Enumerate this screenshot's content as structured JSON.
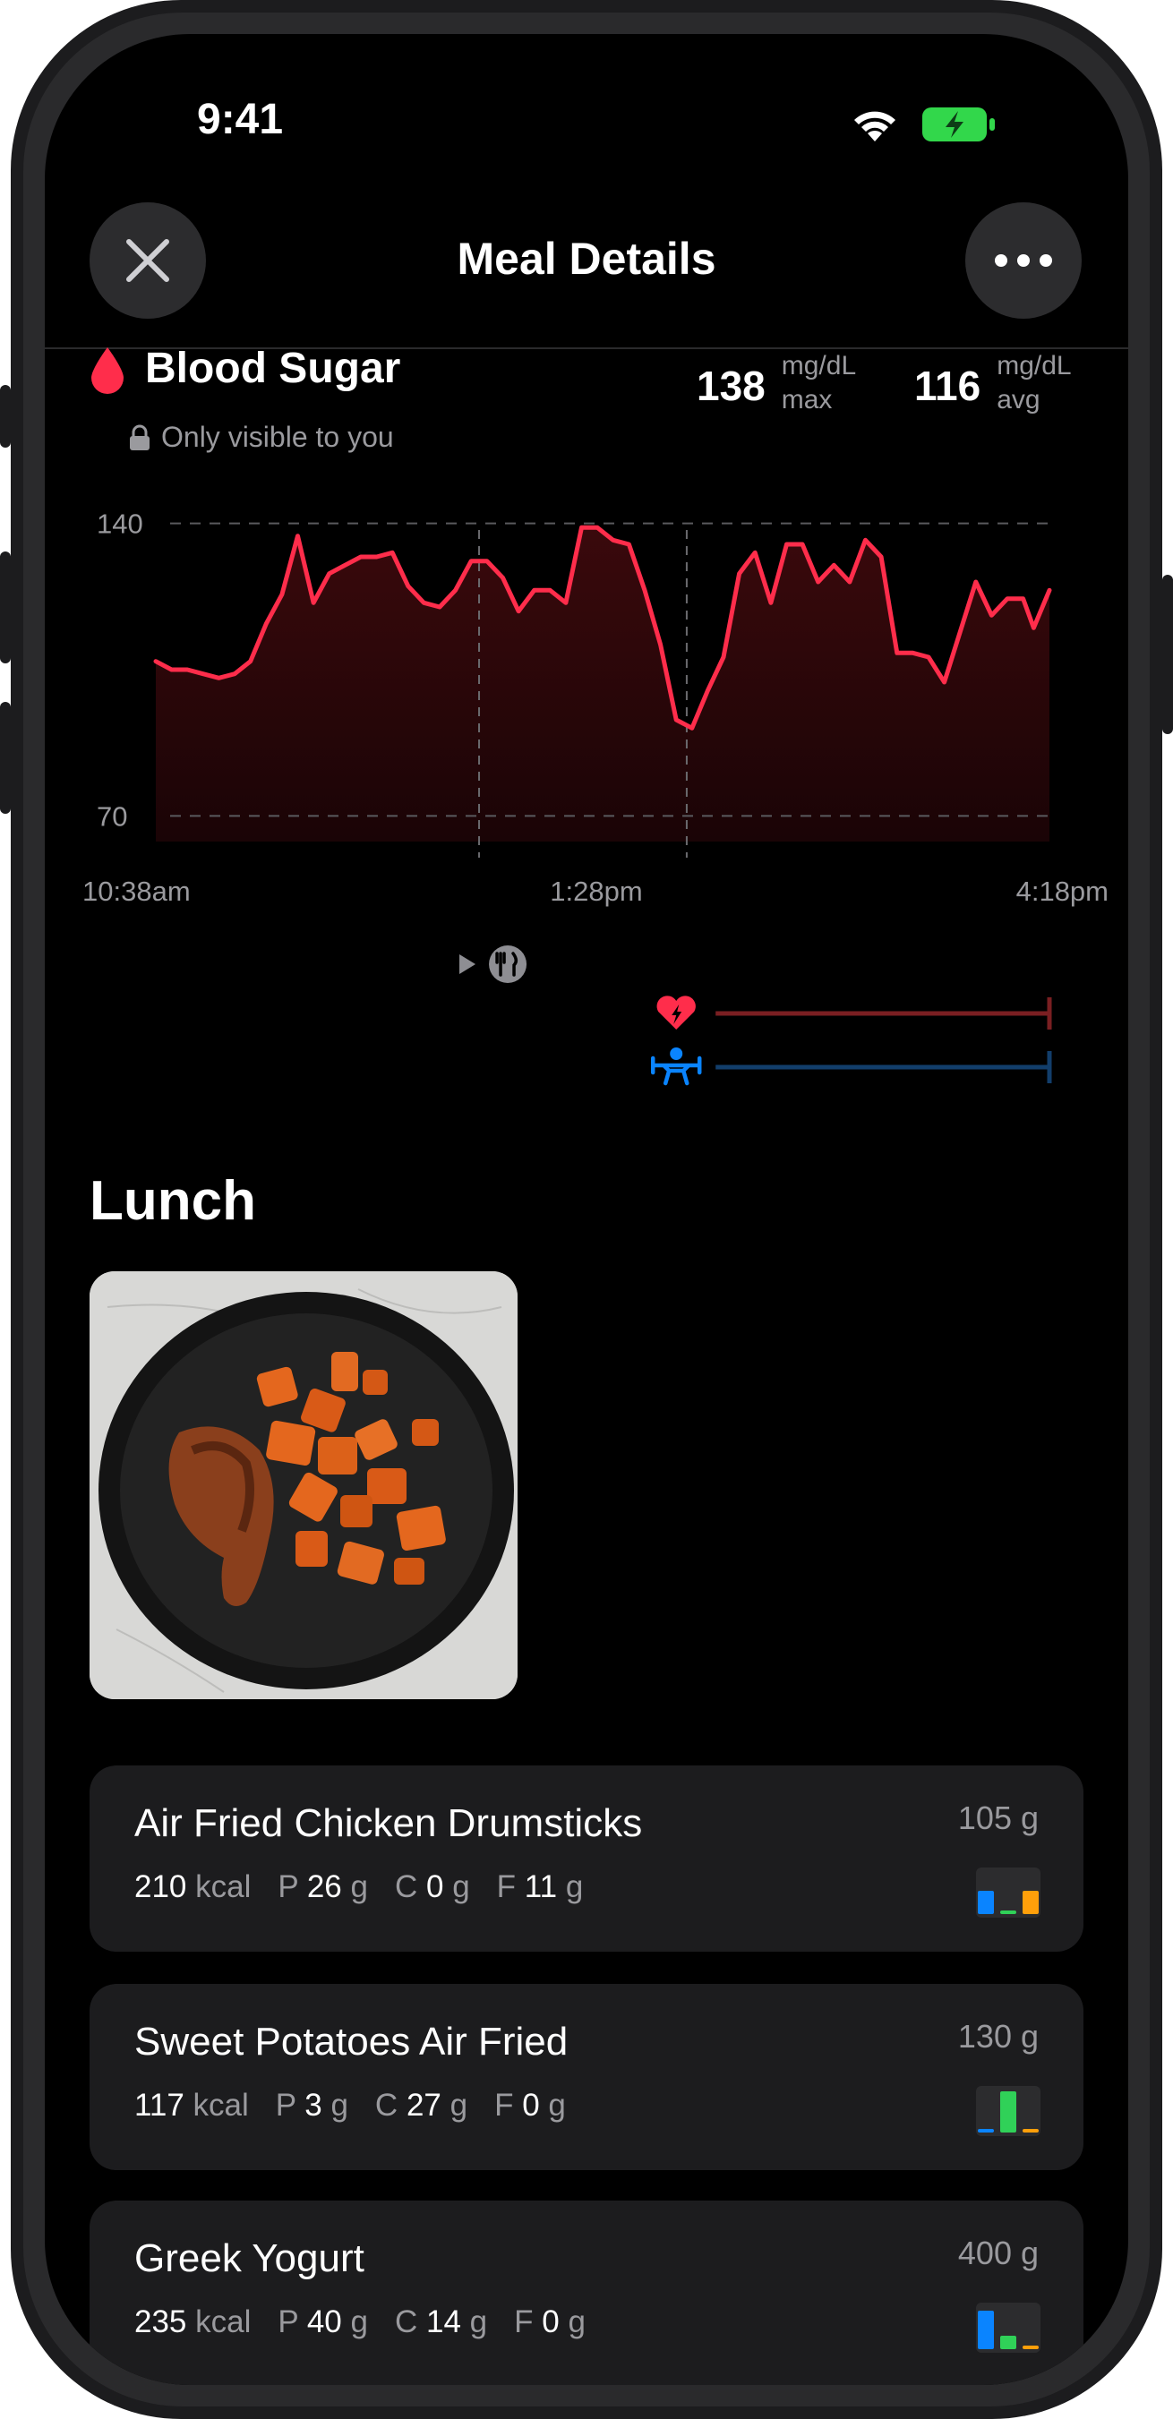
{
  "status_bar": {
    "time": "9:41"
  },
  "header": {
    "title": "Meal Details"
  },
  "blood_sugar": {
    "title": "Blood Sugar",
    "privacy_note": "Only visible to you",
    "max_value": "138",
    "max_unit": "mg/dL",
    "max_label": "max",
    "avg_value": "116",
    "avg_unit": "mg/dL",
    "avg_label": "avg"
  },
  "chart_data": {
    "type": "area",
    "title": "",
    "xlabel": "",
    "ylabel": "",
    "y_ticks": [
      "140",
      "70"
    ],
    "ylim": [
      60,
      150
    ],
    "x_ticks": [
      "10:38am",
      "1:28pm",
      "4:18pm"
    ],
    "x_minutes_range": [
      0,
      340
    ],
    "markers": [
      {
        "label": "meal_start",
        "x": 123
      },
      {
        "label": "meal_end",
        "x": 202
      }
    ],
    "series": [
      {
        "x": [
          0,
          6,
          12,
          18,
          24,
          30,
          36,
          42,
          48,
          54,
          60,
          66,
          72,
          78,
          84,
          90,
          96,
          102,
          108,
          114,
          120,
          126,
          132,
          138,
          144,
          150,
          156,
          162,
          168,
          174,
          180,
          186,
          192,
          198,
          204,
          210,
          216,
          222,
          228,
          234,
          240,
          246,
          252,
          258,
          264,
          270,
          276,
          282,
          288,
          294,
          300,
          306,
          312,
          318,
          324,
          330,
          334,
          340
        ],
        "values": [
          107,
          105,
          105,
          104,
          103,
          104,
          107,
          116,
          123,
          137,
          121,
          128,
          130,
          132,
          132,
          133,
          125,
          121,
          120,
          124,
          131,
          131,
          127,
          119,
          124,
          124,
          121,
          139,
          139,
          136,
          135,
          124,
          111,
          93,
          91,
          100,
          108,
          128,
          133,
          121,
          135,
          135,
          126,
          130,
          126,
          136,
          132,
          109,
          109,
          108,
          102,
          114,
          126,
          118,
          122,
          122,
          115,
          124
        ]
      }
    ],
    "activity_bars": [
      {
        "icon": "heart-bolt-icon",
        "color": "#7a1f22",
        "x_start": 213,
        "x_end": 340
      },
      {
        "icon": "weightlifter-icon",
        "color": "#123e6b",
        "x_start": 213,
        "x_end": 340
      }
    ]
  },
  "meal": {
    "title": "Lunch",
    "photo_alt": "Plate with chicken drumstick and sweet potato cubes"
  },
  "foods": [
    {
      "name": "Air Fried Chicken Drumsticks",
      "weight": "105 g",
      "kcal": "210",
      "kcal_unit": "kcal",
      "p": "26",
      "c": "0",
      "f": "11",
      "p_label": "P",
      "c_label": "C",
      "f_label": "F",
      "g": "g",
      "bars": [
        0.55,
        0.08,
        0.55
      ]
    },
    {
      "name": "Sweet Potatoes Air Fried",
      "weight": "130 g",
      "kcal": "117",
      "kcal_unit": "kcal",
      "p": "3",
      "c": "27",
      "f": "0",
      "p_label": "P",
      "c_label": "C",
      "f_label": "F",
      "g": "g",
      "bars": [
        0.06,
        0.95,
        0.06
      ]
    },
    {
      "name": "Greek Yogurt",
      "weight": "400 g",
      "kcal": "235",
      "kcal_unit": "kcal",
      "p": "40",
      "c": "14",
      "f": "0",
      "p_label": "P",
      "c_label": "C",
      "f_label": "F",
      "g": "g",
      "bars": [
        0.9,
        0.32,
        0.08
      ]
    }
  ],
  "colors": {
    "line": "#ff2d4b",
    "fill": "#2a0608",
    "protein": "#0a84ff",
    "carbs": "#30d158",
    "fat": "#ff9f0a"
  }
}
